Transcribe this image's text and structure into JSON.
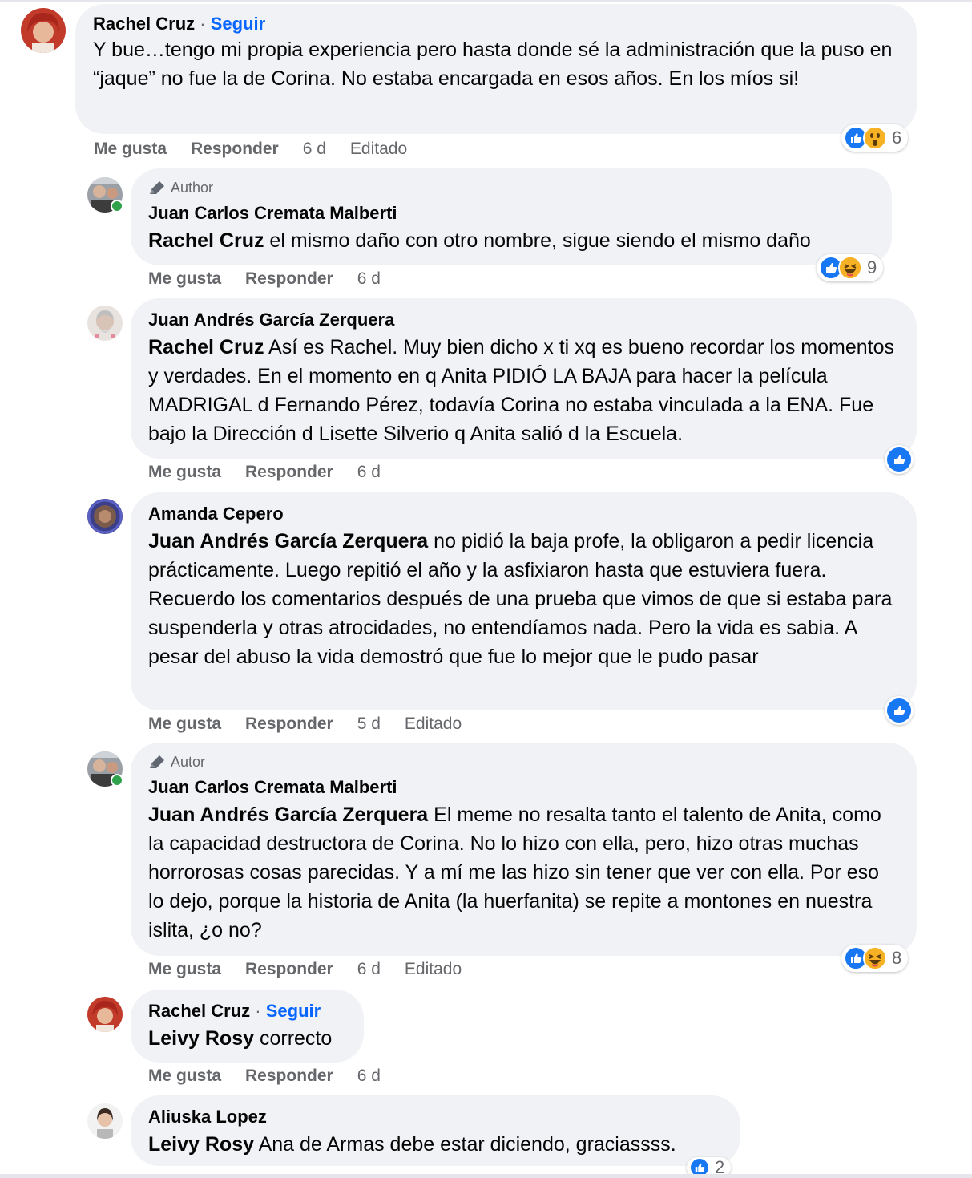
{
  "comments": [
    {
      "name": "Rachel Cruz",
      "separator": "·",
      "follow": "Seguir",
      "text": "Y bue…tengo mi propia experiencia pero hasta donde sé la administración que la puso en “jaque” no fue la de Corina. No estaba encargada en esos años. En los míos si!",
      "like": "Me gusta",
      "reply": "Responder",
      "time": "6 d",
      "edited": "Editado",
      "reactions": [
        "like-icon",
        "wow-icon"
      ],
      "reaction_count": "6"
    },
    {
      "badge": "Author",
      "name": "Juan Carlos Cremata Malberti",
      "mention": "Rachel Cruz",
      "text": " el mismo daño con otro nombre, sigue siendo el mismo daño",
      "like": "Me gusta",
      "reply": "Responder",
      "time": "6 d",
      "reactions": [
        "like-icon",
        "haha-icon"
      ],
      "reaction_count": "9"
    },
    {
      "name": "Juan Andrés García Zerquera",
      "mention": "Rachel Cruz",
      "text": " Así es Rachel. Muy bien dicho x ti xq es bueno recordar los momentos y verdades. En el momento en q Anita PIDIÓ LA BAJA para hacer la película MADRIGAL d Fernando Pérez, todavía Corina no estaba vinculada a la ENA. Fue bajo la Dirección d Lisette Silverio q Anita salió d la Escuela.",
      "like": "Me gusta",
      "reply": "Responder",
      "time": "6 d",
      "reactions": [
        "like-icon"
      ]
    },
    {
      "name": "Amanda Cepero",
      "mention": "Juan Andrés García Zerquera",
      "text": " no pidió la baja profe, la obligaron a pedir licencia prácticamente. Luego repitió el año y la asfixiaron hasta que estuviera fuera. Recuerdo los comentarios después de una prueba que vimos de que si estaba para suspenderla y otras atrocidades, no entendíamos nada. Pero la vida es sabia. A pesar del abuso la vida demostró que fue lo mejor que le pudo pasar",
      "like": "Me gusta",
      "reply": "Responder",
      "time": "5 d",
      "edited": "Editado",
      "reactions": [
        "like-icon"
      ]
    },
    {
      "badge": "Autor",
      "name": "Juan Carlos Cremata Malberti",
      "mention": "Juan Andrés García Zerquera",
      "text": " El meme no resalta tanto el talento de Anita, como la capacidad destructora de Corina. No lo hizo con ella, pero, hizo otras muchas horrorosas cosas parecidas. Y a mí me las hizo sin tener que ver con ella. Por eso lo dejo, porque la historia de Anita (la huerfanita) se repite a montones en nuestra islita, ¿o no?",
      "like": "Me gusta",
      "reply": "Responder",
      "time": "6 d",
      "edited": "Editado",
      "reactions": [
        "like-icon",
        "haha-icon"
      ],
      "reaction_count": "8"
    },
    {
      "name": "Rachel Cruz",
      "follow": "Seguir",
      "mention": "Leivy Rosy",
      "text": " correcto",
      "like": "Me gusta",
      "reply": "Responder",
      "time": "6 d"
    },
    {
      "name": "Aliuska Lopez",
      "mention": "Leivy Rosy",
      "text": " Ana de Armas debe estar diciendo, graciassss.",
      "reactions": [
        "like-icon"
      ],
      "reaction_count": "2"
    }
  ]
}
